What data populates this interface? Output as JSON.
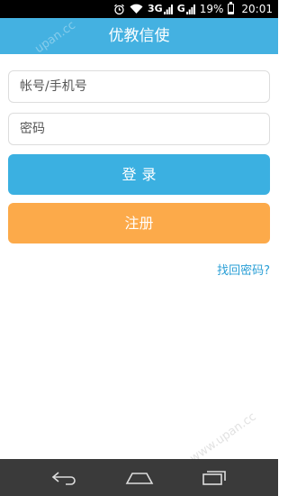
{
  "status_bar": {
    "alarm_icon": "alarm-clock-icon",
    "wifi_icon": "wifi-icon",
    "network_1": "3G",
    "network_2": "G",
    "battery_percent": "19%",
    "battery_level": 0.19,
    "time": "20:01"
  },
  "header": {
    "title": "优教信使"
  },
  "login_form": {
    "account_placeholder": "帐号/手机号",
    "password_placeholder": "密码",
    "login_label": "登录",
    "register_label": "注册",
    "forgot_label": "找回密码?"
  },
  "watermark": {
    "text": "www.upan.cc",
    "top_text": "upan.cc"
  },
  "nav_bar": {
    "back_icon": "back-icon",
    "home_icon": "home-icon",
    "recents_icon": "recents-icon"
  },
  "colors": {
    "header": "#44b1e1",
    "login_button": "#3bb0e1",
    "register_button": "#fcaa4a",
    "link": "#2a9fd6",
    "nav_bar": "#3a3a3a"
  }
}
